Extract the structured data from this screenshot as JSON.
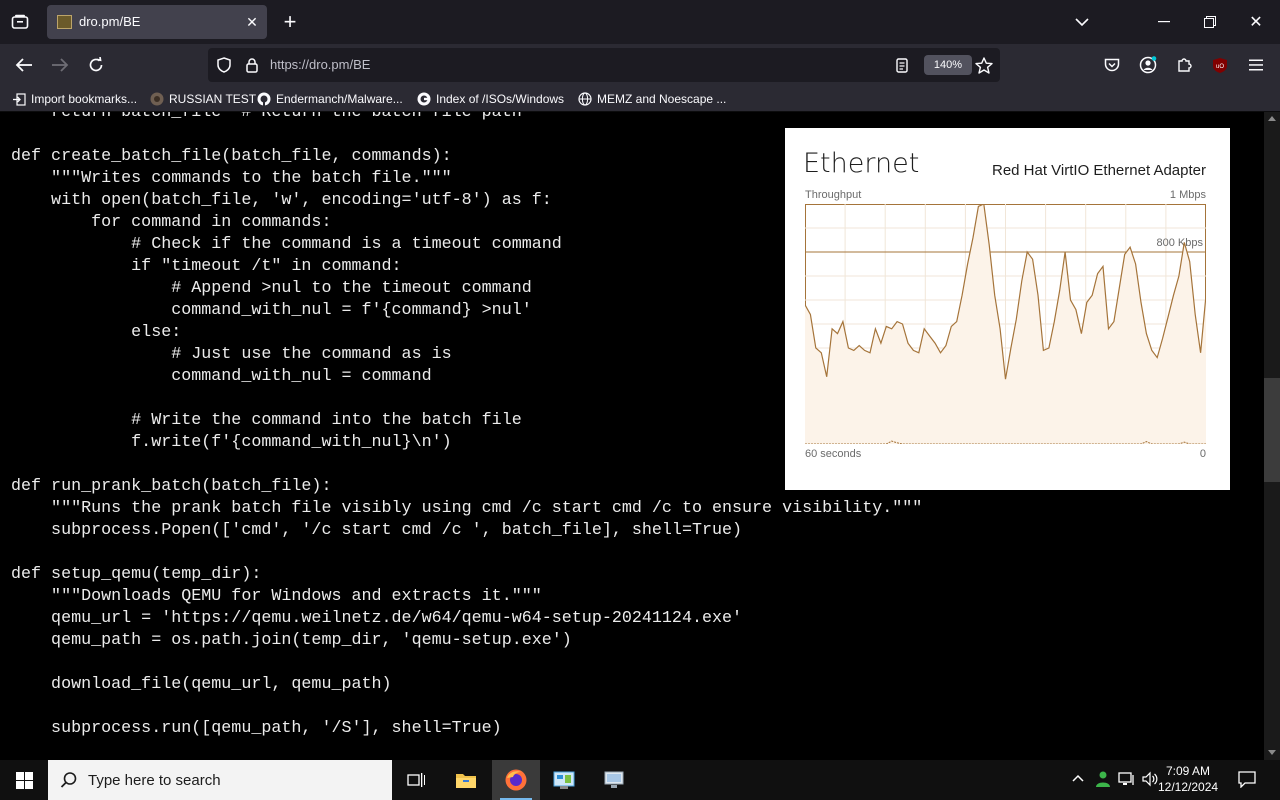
{
  "browser": {
    "tab_title": "dro.pm/BE",
    "url": "https://dro.pm/BE",
    "zoom": "140%"
  },
  "bookmarks": [
    {
      "label": "Import bookmarks...",
      "icon": "import-icon"
    },
    {
      "label": "RUSSIAN TEST",
      "icon": "site-favicon"
    },
    {
      "label": "Endermanch/Malware...",
      "icon": "github-icon"
    },
    {
      "label": "Index of /ISOs/Windows",
      "icon": "google-icon"
    },
    {
      "label": "MEMZ and Noescape ...",
      "icon": "globe-icon"
    }
  ],
  "code_lines": [
    "    return batch_file  # Return the batch file path",
    "",
    "def create_batch_file(batch_file, commands):",
    "    \"\"\"Writes commands to the batch file.\"\"\"",
    "    with open(batch_file, 'w', encoding='utf-8') as f:",
    "        for command in commands:",
    "            # Check if the command is a timeout command",
    "            if \"timeout /t\" in command:",
    "                # Append >nul to the timeout command",
    "                command_with_nul = f'{command} >nul'",
    "            else:",
    "                # Just use the command as is",
    "                command_with_nul = command",
    "",
    "            # Write the command into the batch file",
    "            f.write(f'{command_with_nul}\\n')",
    "",
    "def run_prank_batch(batch_file):",
    "    \"\"\"Runs the prank batch file visibly using cmd /c start cmd /c to ensure visibility.\"\"\"",
    "    subprocess.Popen(['cmd', '/c start cmd /c ', batch_file], shell=True)",
    "",
    "def setup_qemu(temp_dir):",
    "    \"\"\"Downloads QEMU for Windows and extracts it.\"\"\"",
    "    qemu_url = 'https://qemu.weilnetz.de/w64/qemu-w64-setup-20241124.exe'",
    "    qemu_path = os.path.join(temp_dir, 'qemu-setup.exe')",
    "",
    "    download_file(qemu_url, qemu_path)",
    "",
    "    subprocess.run([qemu_path, '/S'], shell=True)"
  ],
  "ethernet_panel": {
    "title": "Ethernet",
    "adapter": "Red Hat VirtIO Ethernet Adapter",
    "throughput_label": "Throughput",
    "max_label": "1 Mbps",
    "mid_label": "800 Kbps",
    "time_label": "60 seconds",
    "min_label": "0",
    "line_color": "#a5743a",
    "fill_color": "#fcf3e9"
  },
  "chart_data": {
    "type": "area",
    "ylabel": "Throughput",
    "ylim": [
      0,
      1000
    ],
    "xlim": [
      60,
      0
    ],
    "x_label": "60 seconds",
    "y_unit": "Kbps",
    "series": [
      {
        "values": [
          580,
          540,
          400,
          380,
          280,
          480,
          460,
          510,
          400,
          390,
          410,
          390,
          380,
          480,
          420,
          490,
          480,
          510,
          500,
          420,
          390,
          380,
          480,
          450,
          420,
          380,
          410,
          490,
          510,
          620,
          750,
          860,
          990,
          1010,
          830,
          620,
          480,
          270,
          400,
          520,
          680,
          800,
          770,
          620,
          390,
          400,
          510,
          640,
          800,
          600,
          560,
          460,
          590,
          620,
          710,
          740,
          480,
          510,
          650,
          790,
          820,
          750,
          590,
          460,
          390,
          360,
          440,
          530,
          620,
          700,
          840,
          760,
          540,
          380,
          620
        ]
      },
      {
        "values": [
          0,
          0,
          0,
          0,
          0,
          0,
          0,
          0,
          0,
          0,
          0,
          0,
          0,
          0,
          0,
          0,
          12,
          5,
          0,
          0,
          0,
          0,
          0,
          0,
          0,
          0,
          0,
          0,
          0,
          0,
          0,
          0,
          0,
          0,
          0,
          0,
          0,
          0,
          0,
          0,
          0,
          0,
          0,
          0,
          0,
          0,
          0,
          0,
          0,
          0,
          0,
          0,
          0,
          0,
          0,
          0,
          0,
          0,
          0,
          0,
          0,
          0,
          0,
          10,
          0,
          0,
          0,
          0,
          0,
          0,
          8,
          0,
          0,
          0,
          0
        ]
      }
    ]
  },
  "taskbar": {
    "search_placeholder": "Type here to search",
    "time": "7:09 AM",
    "date": "12/12/2024"
  }
}
